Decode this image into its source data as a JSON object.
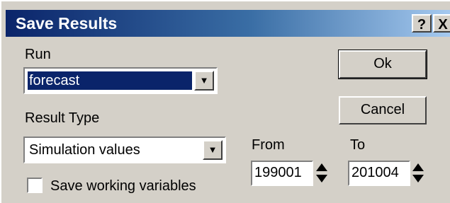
{
  "window": {
    "title": "Save Results",
    "help_glyph": "?",
    "close_glyph": "X"
  },
  "run": {
    "label": "Run",
    "selected": "forecast"
  },
  "result_type": {
    "label": "Result Type",
    "selected": "Simulation values"
  },
  "range": {
    "from_label": "From",
    "from_value": "199001",
    "to_label": "To",
    "to_value": "201004"
  },
  "options": {
    "save_working_label": "Save working variables",
    "save_working_checked": false
  },
  "buttons": {
    "ok": "Ok",
    "cancel": "Cancel"
  },
  "icons": {
    "dropdown": "chevron-down-icon",
    "spinner": "spin-updown-icon"
  }
}
